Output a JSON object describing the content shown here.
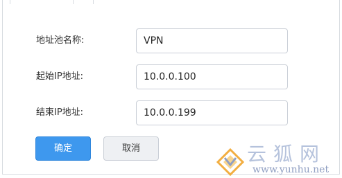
{
  "form": {
    "pool_name": {
      "label": "地址池名称:",
      "value": "VPN"
    },
    "start_ip": {
      "label": "起始IP地址:",
      "value": "10.0.0.100"
    },
    "end_ip": {
      "label": "结束IP地址:",
      "value": "10.0.0.199"
    }
  },
  "actions": {
    "confirm_label": "确定",
    "cancel_label": "取消"
  },
  "watermark": {
    "chars": "云狐网",
    "url": "www.yunhu.net"
  },
  "colors": {
    "primary": "#3e98ee",
    "border": "#c9ced6",
    "text": "#333333",
    "watermark_orange": "#f0a020",
    "watermark_blue": "#7d8fb8"
  }
}
